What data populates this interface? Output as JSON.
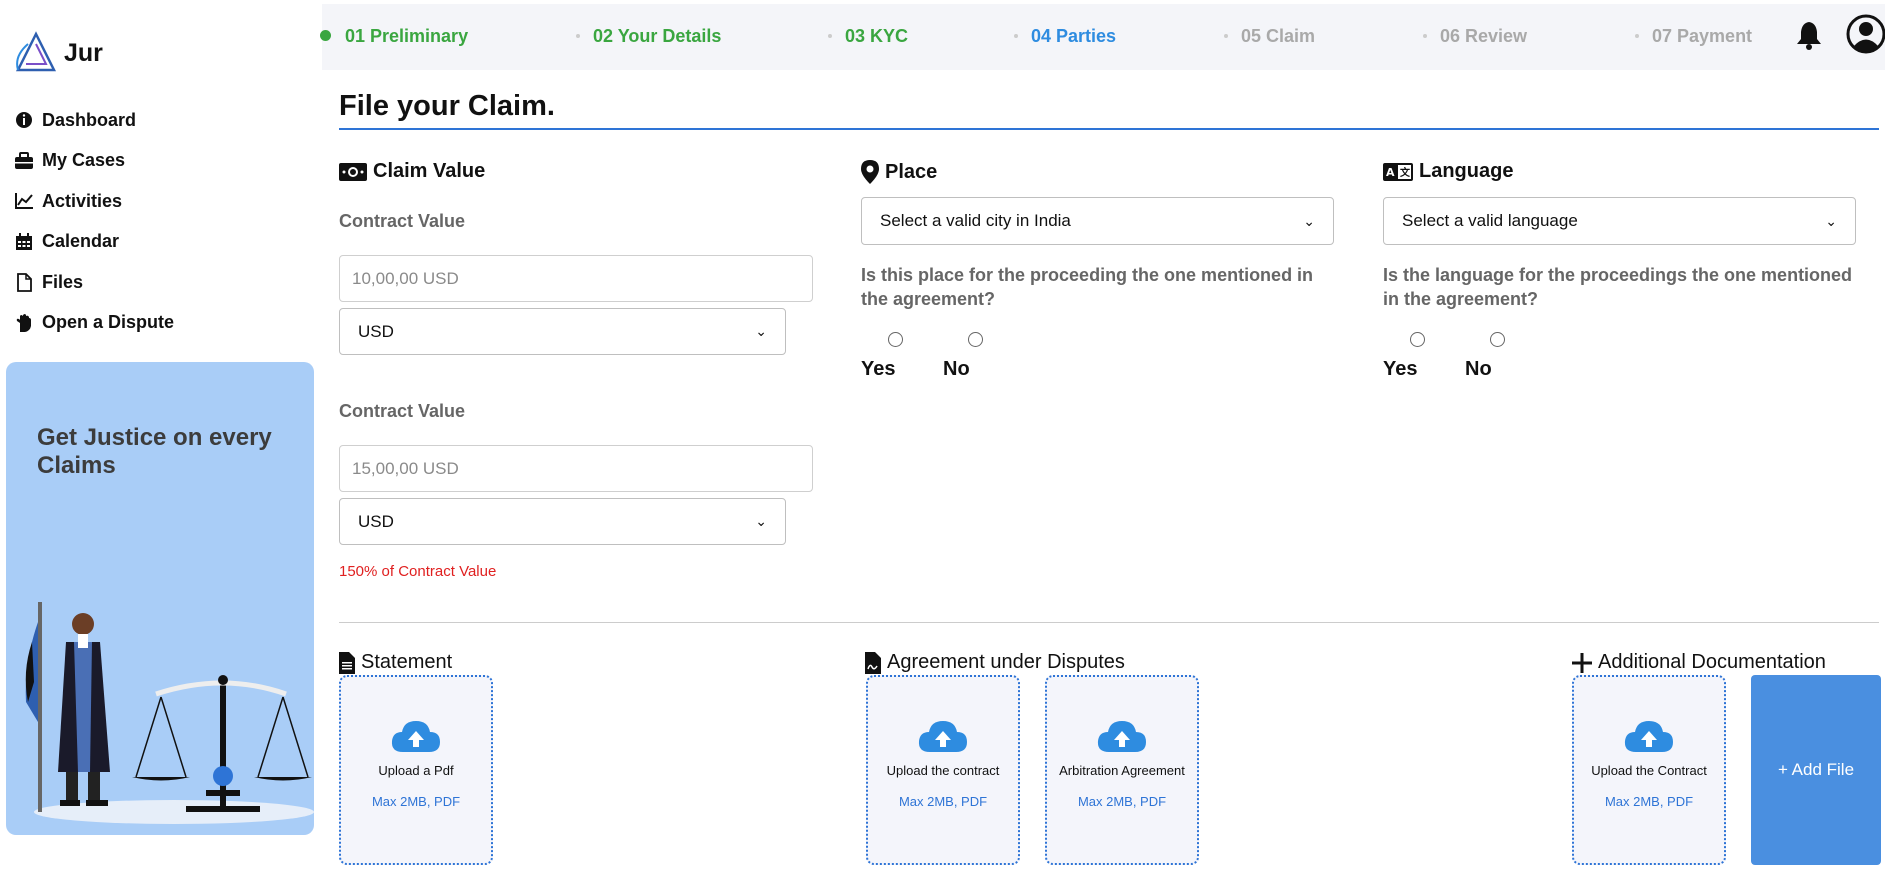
{
  "app": {
    "name": "Jur"
  },
  "sidebar": {
    "items": [
      {
        "label": "Dashboard",
        "icon": "info-circle-icon"
      },
      {
        "label": "My Cases",
        "icon": "briefcase-icon"
      },
      {
        "label": "Activities",
        "icon": "line-chart-icon"
      },
      {
        "label": "Calendar",
        "icon": "calendar-icon"
      },
      {
        "label": "Files",
        "icon": "file-icon"
      },
      {
        "label": "Open a Dispute",
        "icon": "hand-icon"
      }
    ],
    "promo": {
      "text": "Get Justice on every Claims"
    }
  },
  "steps": [
    {
      "label": "01 Preliminary",
      "state": "done"
    },
    {
      "label": "02 Your Details",
      "state": "done"
    },
    {
      "label": "03 KYC",
      "state": "done"
    },
    {
      "label": "04 Parties",
      "state": "active"
    },
    {
      "label": "05 Claim",
      "state": "todo"
    },
    {
      "label": "06 Review",
      "state": "todo"
    },
    {
      "label": "07 Payment",
      "state": "todo"
    }
  ],
  "colors": {
    "done": "#3aa640",
    "active": "#2e8ce0",
    "todo": "#a9a9a9",
    "accent": "#2e74d6",
    "error": "#e02020"
  },
  "main": {
    "title": "File your Claim.",
    "claim": {
      "heading": "Claim Value",
      "contract1": {
        "label": "Contract Value",
        "placeholder": "10,00,00 USD",
        "currency": "USD"
      },
      "contract2": {
        "label": "Contract Value",
        "placeholder": "15,00,00 USD",
        "currency": "USD"
      },
      "note": "150% of Contract Value"
    },
    "place": {
      "heading": "Place",
      "select": "Select a valid city in India",
      "question": "Is this place for the proceeding the one mentioned in the agreement?",
      "yes": "Yes",
      "no": "No"
    },
    "language": {
      "heading": "Language",
      "select": "Select a valid language",
      "question": "Is the language for the proceedings the one mentioned in the agreement?",
      "yes": "Yes",
      "no": "No"
    },
    "documents": {
      "statement": {
        "heading": "Statement",
        "upload": {
          "title": "Upload a Pdf",
          "sub": "Max 2MB, PDF"
        }
      },
      "agreement": {
        "heading": "Agreement under Disputes",
        "upload1": {
          "title": "Upload the contract",
          "sub": "Max 2MB, PDF"
        },
        "upload2": {
          "title": "Arbitration Agreement",
          "sub": "Max 2MB, PDF"
        }
      },
      "additional": {
        "heading": "Additional Documentation",
        "upload": {
          "title": "Upload the Contract",
          "sub": "Max 2MB, PDF"
        },
        "add_label": "+ Add File"
      }
    }
  }
}
